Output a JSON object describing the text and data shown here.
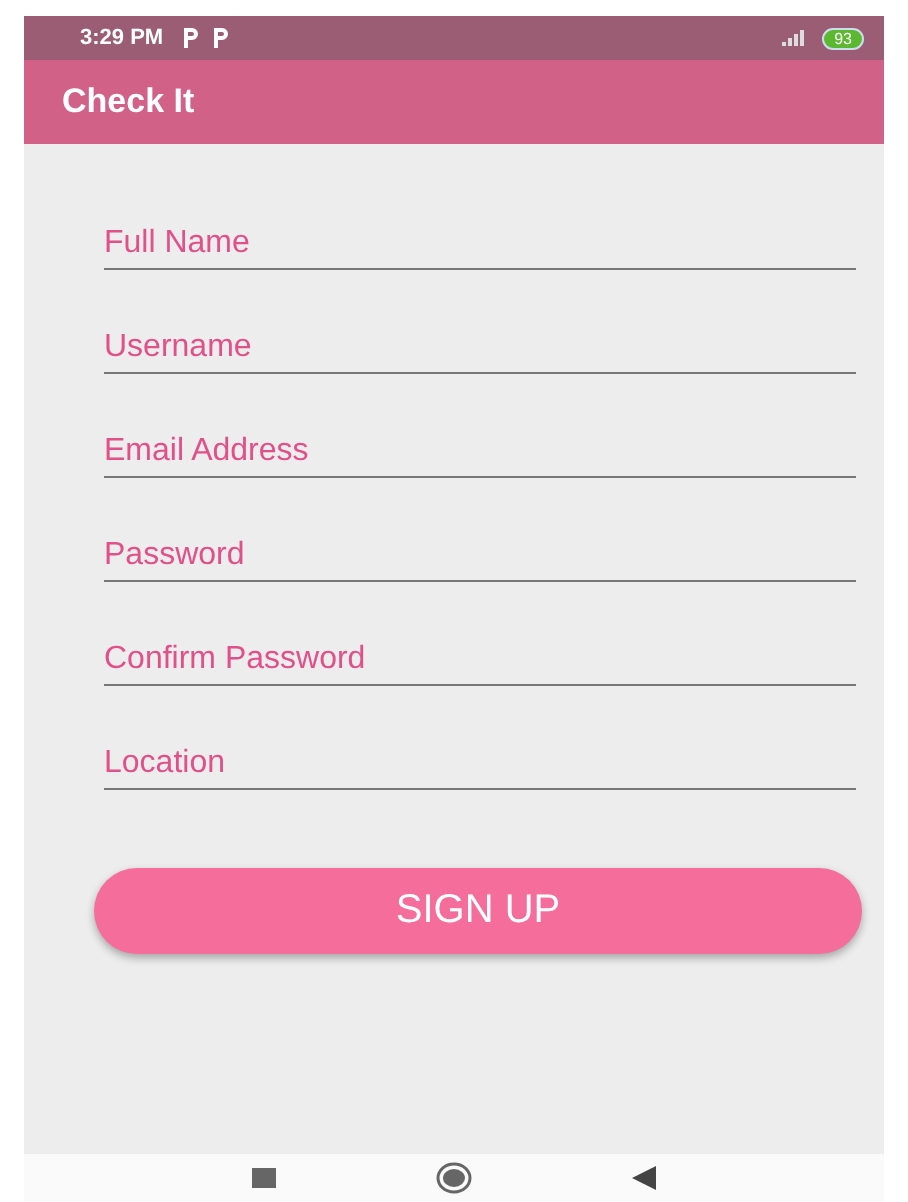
{
  "status_bar": {
    "time": "3:29 PM",
    "battery": "93"
  },
  "app_bar": {
    "title": "Check It"
  },
  "fields": [
    {
      "placeholder": "Full Name"
    },
    {
      "placeholder": "Username"
    },
    {
      "placeholder": "Email Address"
    },
    {
      "placeholder": "Password"
    },
    {
      "placeholder": "Confirm Password"
    },
    {
      "placeholder": "Location"
    }
  ],
  "button": {
    "label": "SIGN UP"
  }
}
